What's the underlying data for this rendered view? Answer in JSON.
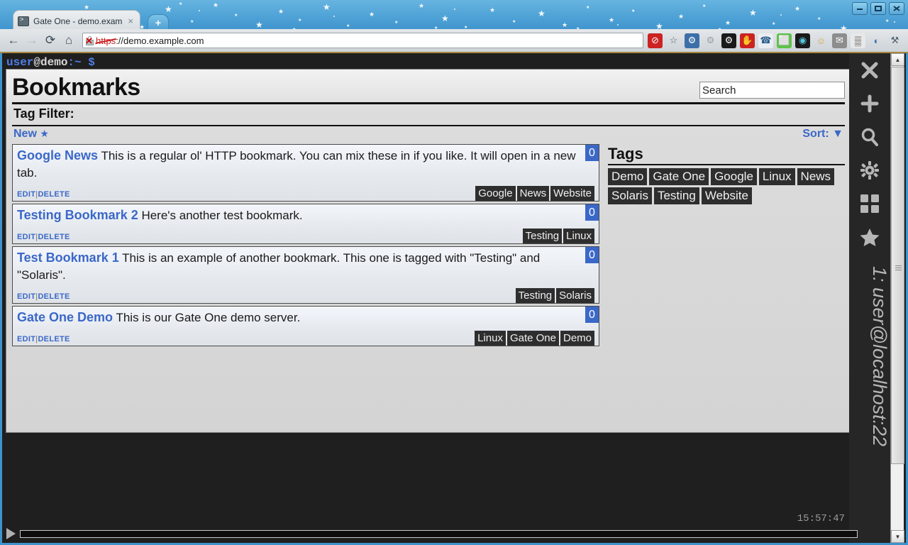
{
  "window": {
    "minimize_label": "minimize",
    "maximize_label": "maximize",
    "close_label": "close"
  },
  "browser": {
    "tab_title": "Gate One - demo.exam",
    "tab_close_label": "×",
    "new_tab_label": "+",
    "back_label": "←",
    "forward_label": "→",
    "reload_label": "⟳",
    "home_label": "⌂",
    "url_scheme": "https",
    "url_rest": "://demo.example.com",
    "extensions": [
      {
        "name": "adblock-icon",
        "glyph": "⊘",
        "bg": "#cc2222",
        "fg": "#ffffff"
      },
      {
        "name": "bookmark-star-icon",
        "glyph": "☆",
        "bg": "transparent",
        "fg": "#56606a"
      },
      {
        "name": "settings-gear-icon",
        "glyph": "⚙",
        "bg": "#3b6fa8",
        "fg": "#ffffff"
      },
      {
        "name": "grey-gear-icon",
        "glyph": "⚙",
        "bg": "transparent",
        "fg": "#9aa0a4"
      },
      {
        "name": "black-gear-icon",
        "glyph": "⚙",
        "bg": "#1a1a1a",
        "fg": "#ffffff"
      },
      {
        "name": "stop-hand-icon",
        "glyph": "✋",
        "bg": "#cc2222",
        "fg": "#ffffff"
      },
      {
        "name": "chat-bubble-icon",
        "glyph": "☎",
        "bg": "#e9eef2",
        "fg": "#2a5c8a"
      },
      {
        "name": "evernote-icon",
        "glyph": "⬜",
        "bg": "#5ec24a",
        "fg": "#ffffff"
      },
      {
        "name": "camera-lens-icon",
        "glyph": "◉",
        "bg": "#1a1a1a",
        "fg": "#57c7e0"
      },
      {
        "name": "smiley-face-icon",
        "glyph": "☺",
        "bg": "transparent",
        "fg": "#d8a53a"
      },
      {
        "name": "mail-icon",
        "glyph": "✉",
        "bg": "#8d8d8d",
        "fg": "#ffffff"
      },
      {
        "name": "barcode-icon",
        "glyph": "▒",
        "bg": "#e8e8e8",
        "fg": "#333333"
      },
      {
        "name": "python-icon",
        "glyph": "◐",
        "bg": "transparent",
        "fg": "#3a72a8"
      },
      {
        "name": "wrench-icon",
        "glyph": "⚒",
        "bg": "transparent",
        "fg": "#4a5c6a"
      }
    ]
  },
  "terminal": {
    "prompt_user": "user",
    "prompt_host": "@demo",
    "prompt_colon": ":~ ",
    "prompt_symbol": "$",
    "clock": "15:57:47",
    "session_label": "1: user@localhost:22",
    "play_label": "play",
    "sidebar_icons": [
      {
        "name": "close-icon",
        "label": "close"
      },
      {
        "name": "plus-icon",
        "label": "new terminal"
      },
      {
        "name": "search-icon",
        "label": "search"
      },
      {
        "name": "gear-icon",
        "label": "preferences"
      },
      {
        "name": "grid-icon",
        "label": "grid view"
      },
      {
        "name": "star-icon",
        "label": "bookmarks"
      }
    ]
  },
  "bookmarks": {
    "title": "Bookmarks",
    "search_value": "Search",
    "search_placeholder": "Search",
    "tag_filter_label": "Tag Filter:",
    "new_label": "New",
    "new_star": "★",
    "sort_label": "Sort:",
    "sort_arrow": "▼",
    "edit_label": "EDIT",
    "separator": "|",
    "delete_label": "DELETE",
    "items": [
      {
        "name": "Google News",
        "description": "This is a regular ol' HTTP bookmark. You can mix these in if you like. It will open in a new tab.",
        "count": "0",
        "tags": [
          "Google",
          "News",
          "Website"
        ]
      },
      {
        "name": "Testing Bookmark 2",
        "description": "Here's another test bookmark.",
        "count": "0",
        "tags": [
          "Testing",
          "Linux"
        ]
      },
      {
        "name": "Test Bookmark 1",
        "description": "This is an example of another bookmark. This one is tagged with \"Testing\" and \"Solaris\".",
        "count": "0",
        "tags": [
          "Testing",
          "Solaris"
        ]
      },
      {
        "name": "Gate One Demo",
        "description": "This is our Gate One demo server.",
        "count": "0",
        "tags": [
          "Linux",
          "Gate One",
          "Demo"
        ]
      }
    ],
    "tags_panel": {
      "title": "Tags",
      "tags": [
        "Demo",
        "Gate One",
        "Google",
        "Linux",
        "News",
        "Solaris",
        "Testing",
        "Website"
      ]
    }
  },
  "colors": {
    "accent_blue": "#3b68c8",
    "chrome_blue": "#3e93cc",
    "tag_dark": "#2e2e2e",
    "terminal_bg": "#1f1f1f"
  }
}
